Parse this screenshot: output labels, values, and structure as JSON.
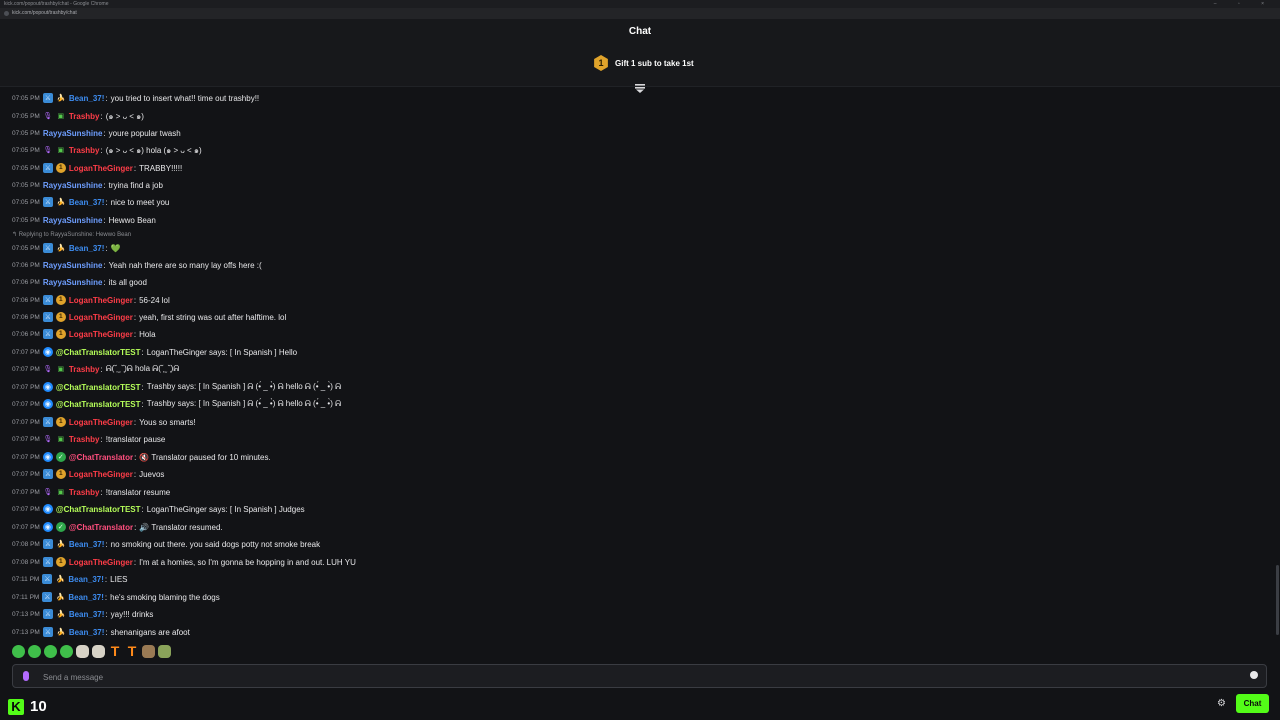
{
  "browser": {
    "title": "kick.com/popout/trashby/chat - Google Chrome",
    "url": "kick.com/popout/trashby/chat"
  },
  "header": {
    "title": "Chat"
  },
  "gift": {
    "badge": "1",
    "text": "Gift 1 sub to take 1st"
  },
  "reply_note": "Replying to RayyaSunshine: Hewwo Bean",
  "messages": [
    {
      "time": "07:05 PM",
      "user": "Bean_37!",
      "text": "you tried to insert what!! time out trashby!!"
    },
    {
      "time": "07:05 PM",
      "user": "Trashby",
      "text": "(๑ > ᴗ < ๑)"
    },
    {
      "time": "07:05 PM",
      "user": "RayyaSunshine",
      "text": "youre popular twash"
    },
    {
      "time": "07:05 PM",
      "user": "Trashby",
      "text": "(๑ > ᴗ < ๑) hola (๑ > ᴗ < ๑)"
    },
    {
      "time": "07:05 PM",
      "user": "LoganTheGinger",
      "text": "TRABBY!!!!!"
    },
    {
      "time": "07:05 PM",
      "user": "RayyaSunshine",
      "text": "tryina find a job"
    },
    {
      "time": "07:05 PM",
      "user": "Bean_37!",
      "text": "nice to meet you"
    },
    {
      "time": "07:05 PM",
      "user": "RayyaSunshine",
      "text": "Hewwo Bean"
    },
    {
      "time": "07:05 PM",
      "user": "Bean_37!",
      "text": "💚"
    },
    {
      "time": "07:06 PM",
      "user": "RayyaSunshine",
      "text": "Yeah nah there are so many lay offs here :("
    },
    {
      "time": "07:06 PM",
      "user": "RayyaSunshine",
      "text": "its all good"
    },
    {
      "time": "07:06 PM",
      "user": "LoganTheGinger",
      "text": "56-24 lol"
    },
    {
      "time": "07:06 PM",
      "user": "LoganTheGinger",
      "text": "yeah, first string was out after halftime. lol"
    },
    {
      "time": "07:06 PM",
      "user": "LoganTheGinger",
      "text": "Hola"
    },
    {
      "time": "07:07 PM",
      "user": "@ChatTranslatorTEST",
      "text": "LoganTheGinger says: [ In Spanish ] Hello"
    },
    {
      "time": "07:07 PM",
      "user": "Trashby",
      "text": "ᕱ(˘̩ ̫ ˘̩)ᕱ hola ᕱ(˘̩ ̫ ˘̩)ᕱ"
    },
    {
      "time": "07:07 PM",
      "user": "@ChatTranslatorTEST",
      "text": "Trashby says: [ In Spanish ] ᕱ (•́ _ •̀) ᕱ hello ᕱ (•́ _ •̀) ᕱ"
    },
    {
      "time": "07:07 PM",
      "user": "@ChatTranslatorTEST",
      "text": "Trashby says: [ In Spanish ] ᕱ (•́ _ •̀) ᕱ hello ᕱ (•́ _ •̀) ᕱ"
    },
    {
      "time": "07:07 PM",
      "user": "LoganTheGinger",
      "text": "Yous so smarts!"
    },
    {
      "time": "07:07 PM",
      "user": "Trashby",
      "text": "!translator pause"
    },
    {
      "time": "07:07 PM",
      "user": "@ChatTranslator",
      "text": "🔇 Translator paused for 10 minutes."
    },
    {
      "time": "07:07 PM",
      "user": "LoganTheGinger",
      "text": "Juevos"
    },
    {
      "time": "07:07 PM",
      "user": "Trashby",
      "text": "!translator resume"
    },
    {
      "time": "07:07 PM",
      "user": "@ChatTranslatorTEST",
      "text": "LoganTheGinger says: [ In Spanish ] Judges"
    },
    {
      "time": "07:07 PM",
      "user": "@ChatTranslator",
      "text": "🔊 Translator resumed."
    },
    {
      "time": "07:08 PM",
      "user": "Bean_37!",
      "text": "no smoking out there. you said dogs potty not smoke break"
    },
    {
      "time": "07:08 PM",
      "user": "LoganTheGinger",
      "text": "I'm at a homies, so I'm gonna be hopping in and out. LUH YU"
    },
    {
      "time": "07:11 PM",
      "user": "Bean_37!",
      "text": "LIES"
    },
    {
      "time": "07:11 PM",
      "user": "Bean_37!",
      "text": "he's smoking blaming the dogs"
    },
    {
      "time": "07:13 PM",
      "user": "Bean_37!",
      "text": "yay!!! drinks"
    },
    {
      "time": "07:13 PM",
      "user": "Bean_37!",
      "text": "shenanigans are afoot"
    }
  ],
  "input": {
    "placeholder": "Send a message"
  },
  "footer": {
    "count": "10",
    "chat_button": "Chat"
  },
  "colors": {
    "accent": "#53fc18",
    "background": "#121316",
    "user_blue": "#6e9eff",
    "user_red": "#ff3d48",
    "user_green": "#b6ff5a",
    "user_pink": "#ff4f7e"
  }
}
